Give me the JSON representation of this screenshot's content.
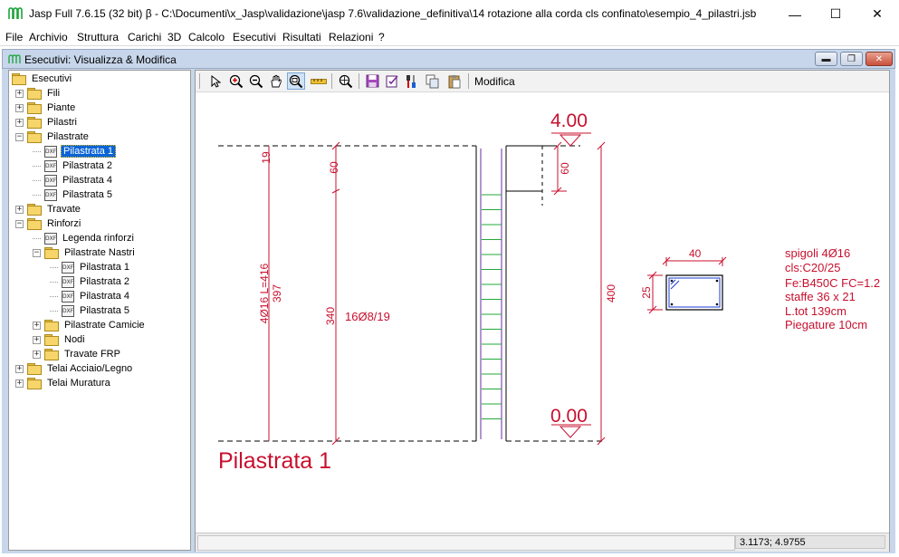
{
  "window": {
    "title": "Jasp Full 7.6.15 (32 bit)  β - C:\\Documenti\\x_Jasp\\validazione\\jasp 7.6\\validazione_definitiva\\14 rotazione alla corda cls confinato\\esempio_4_pilastri.jsb",
    "minimize": "—",
    "maximize": "☐",
    "close": "✕"
  },
  "menu": [
    "File",
    "Archivio",
    "Struttura",
    "Carichi",
    "3D",
    "Calcolo",
    "Esecutivi",
    "Risultati",
    "Relazioni",
    "?"
  ],
  "child_window": {
    "title": "Esecutivi: Visualizza & Modifica"
  },
  "tree": [
    {
      "label": "Esecutivi",
      "icon": "folder-open-icon",
      "expander": "",
      "level": 0
    },
    {
      "label": "Fili",
      "icon": "folder-icon",
      "expander": "+",
      "level": 1
    },
    {
      "label": "Piante",
      "icon": "folder-icon",
      "expander": "+",
      "level": 1
    },
    {
      "label": "Pilastri",
      "icon": "folder-icon",
      "expander": "+",
      "level": 1
    },
    {
      "label": "Pilastrate",
      "icon": "folder-open-icon",
      "expander": "−",
      "level": 1
    },
    {
      "label": "Pilastrata 1",
      "icon": "dxf-icon",
      "expander": "",
      "level": 2,
      "selected": true
    },
    {
      "label": "Pilastrata 2",
      "icon": "dxf-icon",
      "expander": "",
      "level": 2
    },
    {
      "label": "Pilastrata 4",
      "icon": "dxf-icon",
      "expander": "",
      "level": 2
    },
    {
      "label": "Pilastrata 5",
      "icon": "dxf-icon",
      "expander": "",
      "level": 2
    },
    {
      "label": "Travate",
      "icon": "folder-icon",
      "expander": "+",
      "level": 1
    },
    {
      "label": "Rinforzi",
      "icon": "folder-open-icon",
      "expander": "−",
      "level": 1
    },
    {
      "label": "Legenda rinforzi",
      "icon": "dxf-icon",
      "expander": "",
      "level": 2
    },
    {
      "label": "Pilastrate Nastri",
      "icon": "folder-open-icon",
      "expander": "−",
      "level": 2
    },
    {
      "label": "Pilastrata 1",
      "icon": "dxf-icon",
      "expander": "",
      "level": 3
    },
    {
      "label": "Pilastrata 2",
      "icon": "dxf-icon",
      "expander": "",
      "level": 3
    },
    {
      "label": "Pilastrata 4",
      "icon": "dxf-icon",
      "expander": "",
      "level": 3
    },
    {
      "label": "Pilastrata 5",
      "icon": "dxf-icon",
      "expander": "",
      "level": 3
    },
    {
      "label": "Pilastrate Camicie",
      "icon": "folder-icon",
      "expander": "+",
      "level": 2
    },
    {
      "label": "Nodi",
      "icon": "folder-icon",
      "expander": "+",
      "level": 2
    },
    {
      "label": "Travate FRP",
      "icon": "folder-icon",
      "expander": "+",
      "level": 2
    },
    {
      "label": "Telai Acciaio/Legno",
      "icon": "folder-icon",
      "expander": "+",
      "level": 1
    },
    {
      "label": "Telai Muratura",
      "icon": "folder-icon",
      "expander": "+",
      "level": 1
    }
  ],
  "toolbar": {
    "tools": [
      "pointer-icon",
      "zoom-in-icon",
      "zoom-out-icon",
      "pan-icon",
      "zoom-window-icon",
      "measure-icon",
      "zoom-extents-icon",
      "save-icon",
      "edit-icon",
      "tools-icon",
      "copy-icon",
      "paste-icon"
    ],
    "modifica_label": "Modifica"
  },
  "drawing": {
    "level_top": "4.00",
    "level_bottom": "0.00",
    "dim_19": "19",
    "dim_60_left": "60",
    "dim_60_right": "60",
    "dim_397": "397",
    "dim_340": "340",
    "dim_400": "400",
    "bars_label": "4Ø16 L=416",
    "stirrups_label": "16Ø8/19",
    "section_width": "40",
    "section_height": "25",
    "notes": [
      "spigoli 4Ø16",
      "cls:C20/25",
      "Fe:B450C FC=1.2",
      "staffe 36 x 21",
      "L.tot 139cm",
      "Piegature 10cm"
    ],
    "caption": "Pilastrata 1",
    "color": "#c8102e"
  },
  "status": {
    "message": "",
    "coords": "3.1173; 4.9755"
  }
}
